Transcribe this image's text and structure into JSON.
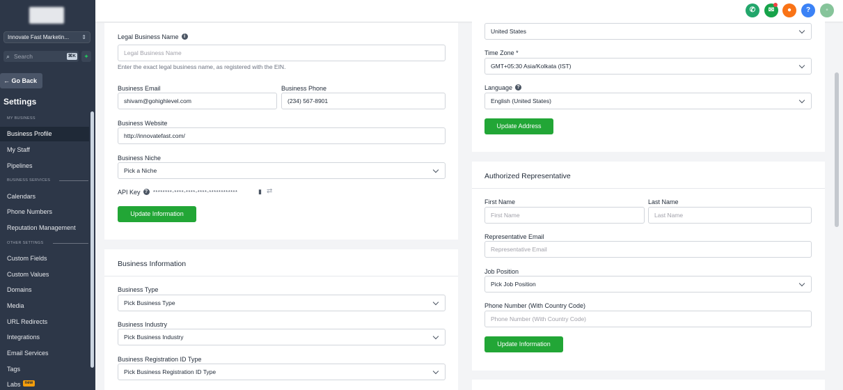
{
  "sidebar": {
    "location": "Innovate Fast Marketin...",
    "search_placeholder": "Search",
    "search_shortcut": "⌘K",
    "go_back": "Go Back",
    "title": "Settings",
    "sections": {
      "my_business": "MY BUSINESS",
      "business_services": "BUSINESS SERVICES",
      "other_settings": "OTHER SETTINGS"
    },
    "items": {
      "business_profile": "Business Profile",
      "my_staff": "My Staff",
      "pipelines": "Pipelines",
      "calendars": "Calendars",
      "phone_numbers": "Phone Numbers",
      "reputation_management": "Reputation Management",
      "custom_fields": "Custom Fields",
      "custom_values": "Custom Values",
      "domains": "Domains",
      "media": "Media",
      "url_redirects": "URL Redirects",
      "integrations": "Integrations",
      "email_services": "Email Services",
      "tags": "Tags",
      "labs": "Labs"
    },
    "labs_badge": "new"
  },
  "topbar": {
    "icons": [
      {
        "name": "phone-icon",
        "color": "#22a66b"
      },
      {
        "name": "megaphone-icon",
        "color": "#16a34a"
      },
      {
        "name": "notification-icon",
        "color": "#f97316"
      },
      {
        "name": "help-icon",
        "color": "#3b82f6"
      },
      {
        "name": "avatar",
        "color": "#86c49a"
      }
    ]
  },
  "general": {
    "legal_name_label": "Legal Business Name",
    "legal_name_placeholder": "Legal Business Name",
    "legal_name_hint": "Enter the exact legal business name, as registered with the EIN.",
    "email_label": "Business Email",
    "email_value": "shivam@gohighlevel.com",
    "phone_label": "Business Phone",
    "phone_value": "(234) 567-8901",
    "website_label": "Business Website",
    "website_value": "http://innovatefast.com/",
    "niche_label": "Business Niche",
    "niche_value": "Pick a Niche",
    "api_key_label": "API Key",
    "api_key_value": "********-****-****-****-************",
    "update_button": "Update Information"
  },
  "business_info": {
    "title": "Business Information",
    "type_label": "Business Type",
    "type_value": "Pick Business Type",
    "industry_label": "Business Industry",
    "industry_value": "Pick Business Industry",
    "reg_id_label": "Business Registration ID Type",
    "reg_id_value": "Pick Business Registration ID Type"
  },
  "address": {
    "country_value": "United States",
    "timezone_label": "Time Zone *",
    "timezone_value": "GMT+05:30 Asia/Kolkata (IST)",
    "language_label": "Language",
    "language_value": "English (United States)",
    "update_button": "Update Address"
  },
  "representative": {
    "title": "Authorized Representative",
    "first_name_label": "First Name",
    "first_name_placeholder": "First Name",
    "last_name_label": "Last Name",
    "last_name_placeholder": "Last Name",
    "email_label": "Representative Email",
    "email_placeholder": "Representative Email",
    "job_label": "Job Position",
    "job_value": "Pick Job Position",
    "phone_label": "Phone Number (With Country Code)",
    "phone_placeholder": "Phone Number (With Country Code)",
    "update_button": "Update Information"
  }
}
